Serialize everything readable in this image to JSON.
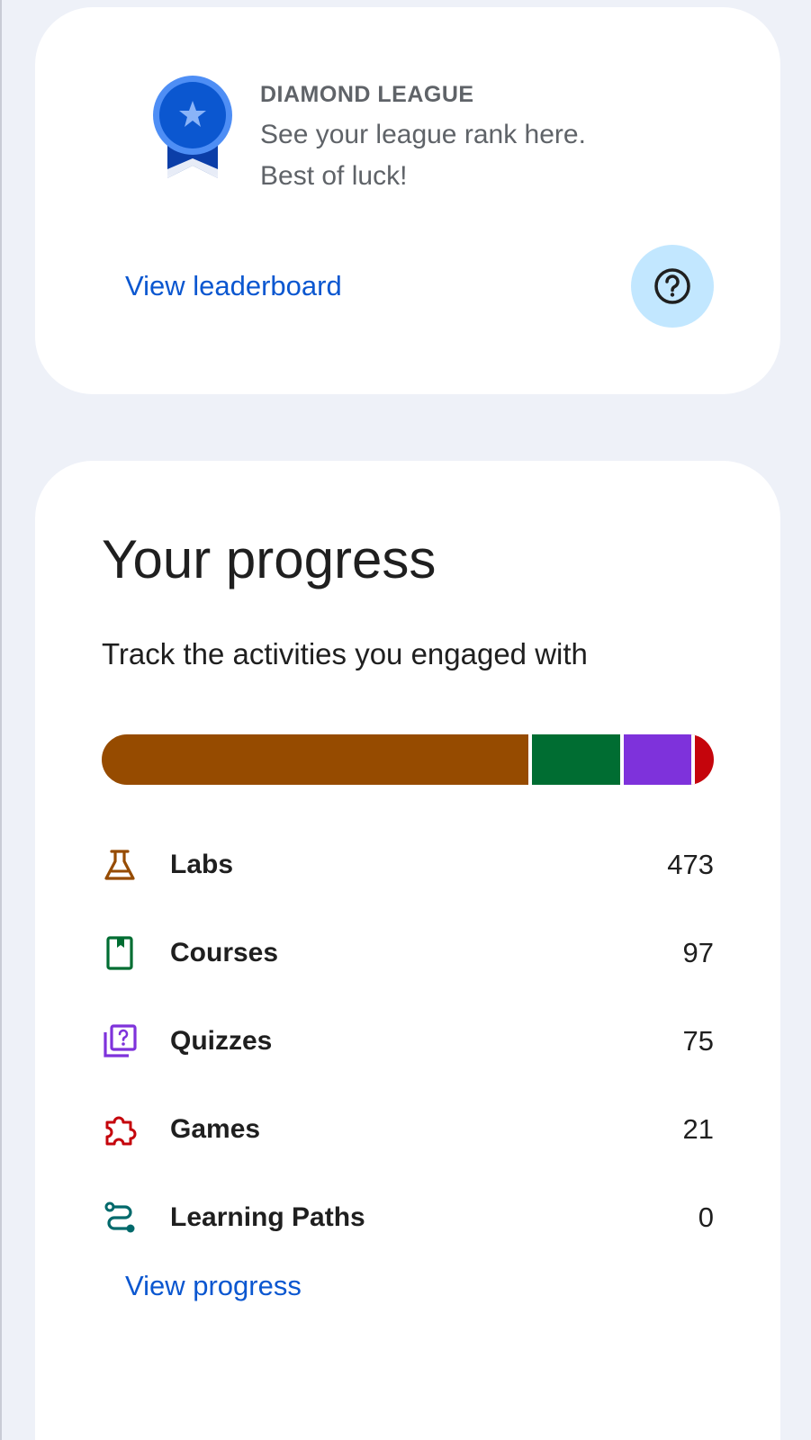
{
  "league": {
    "title": "DIAMOND LEAGUE",
    "line1": "See your league rank here.",
    "line2": "Best of luck!",
    "view_leaderboard": "View leaderboard",
    "badge_icon": "ribbon-badge-icon",
    "help_icon": "help-circle-icon"
  },
  "progress": {
    "title": "Your progress",
    "subtitle": "Track the activities you engaged with",
    "items": [
      {
        "label": "Labs",
        "value": "473",
        "color": "#964b00",
        "icon": "flask-icon"
      },
      {
        "label": "Courses",
        "value": "97",
        "color": "#006d32",
        "icon": "book-icon"
      },
      {
        "label": "Quizzes",
        "value": "75",
        "color": "#7e32db",
        "icon": "quiz-icon"
      },
      {
        "label": "Games",
        "value": "21",
        "color": "#c5050c",
        "icon": "puzzle-icon"
      },
      {
        "label": "Learning Paths",
        "value": "0",
        "color": "#00696b",
        "icon": "route-icon"
      }
    ],
    "view_progress": "View progress"
  }
}
